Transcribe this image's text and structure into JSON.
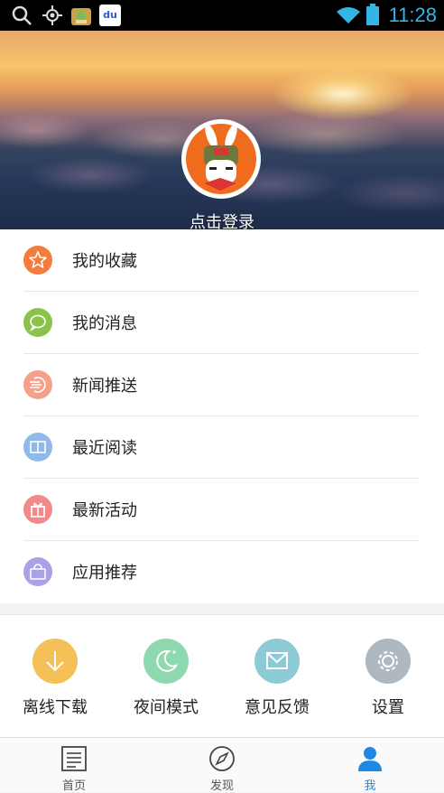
{
  "status_bar": {
    "time": "11:28",
    "left_icons": [
      "search-icon",
      "location-icon",
      "app-notification-icon",
      "baidu-icon"
    ],
    "right_icons": [
      "wifi-icon",
      "battery-icon"
    ],
    "baidu_text": "du"
  },
  "header": {
    "login_label": "点击登录"
  },
  "menu": {
    "items": [
      {
        "label": "我的收藏",
        "icon": "star-icon",
        "color": "#f47c3c"
      },
      {
        "label": "我的消息",
        "icon": "message-icon",
        "color": "#8bc34a"
      },
      {
        "label": "新闻推送",
        "icon": "push-icon",
        "color": "#f5a08a"
      },
      {
        "label": "最近阅读",
        "icon": "book-icon",
        "color": "#8fb9ea"
      },
      {
        "label": "最新活动",
        "icon": "gift-icon",
        "color": "#f28a8a"
      },
      {
        "label": "应用推荐",
        "icon": "bag-icon",
        "color": "#a9a2e6"
      }
    ]
  },
  "tools": [
    {
      "label": "离线下载",
      "icon": "download-icon",
      "color": "#f5c058"
    },
    {
      "label": "夜间模式",
      "icon": "moon-icon",
      "color": "#8fd9b0"
    },
    {
      "label": "意见反馈",
      "icon": "mail-icon",
      "color": "#8ccbd6"
    },
    {
      "label": "设置",
      "icon": "gear-icon",
      "color": "#aeb8c0"
    }
  ],
  "bottom_nav": [
    {
      "label": "首页",
      "icon": "news-icon",
      "active": false
    },
    {
      "label": "发现",
      "icon": "compass-icon",
      "active": false
    },
    {
      "label": "我",
      "icon": "user-icon",
      "active": true
    }
  ],
  "colors": {
    "accent": "#33b5e5",
    "active_tab": "#1e88e5"
  }
}
